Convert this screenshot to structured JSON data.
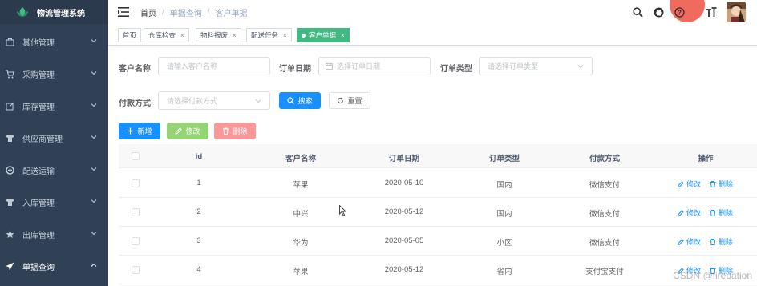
{
  "app": {
    "title": "物流管理系统"
  },
  "sidebar": {
    "items": [
      {
        "label": "其他管理",
        "icon": "bag-icon"
      },
      {
        "label": "采购管理",
        "icon": "cart-icon"
      },
      {
        "label": "库存管理",
        "icon": "edit-icon"
      },
      {
        "label": "供应商管理",
        "icon": "shirt-icon"
      },
      {
        "label": "配送运输",
        "icon": "target-icon"
      },
      {
        "label": "入库管理",
        "icon": "shirt-icon"
      },
      {
        "label": "出库管理",
        "icon": "star-icon"
      },
      {
        "label": "单据查询",
        "icon": "send-icon"
      }
    ]
  },
  "breadcrumb": [
    "首页",
    "单据查询",
    "客户单据"
  ],
  "tags": [
    {
      "label": "首页",
      "closable": false
    },
    {
      "label": "仓库检查",
      "closable": true
    },
    {
      "label": "物料报废",
      "closable": true
    },
    {
      "label": "配送任务",
      "closable": true
    },
    {
      "label": "客户单据",
      "closable": true,
      "active": true
    }
  ],
  "filters": {
    "customer_label": "客户名称",
    "customer_placeholder": "请输入客户名称",
    "date_label": "订单日期",
    "date_placeholder": "选择订单日期",
    "type_label": "订单类型",
    "type_placeholder": "请选择订单类型",
    "pay_label": "付款方式",
    "pay_placeholder": "请选择付款方式",
    "search_label": "搜索",
    "reset_label": "重置"
  },
  "toolbar": {
    "add_label": "新增",
    "edit_label": "修改",
    "delete_label": "删除"
  },
  "table": {
    "headers": [
      "id",
      "客户名称",
      "订单日期",
      "订单类型",
      "付款方式",
      "操作"
    ],
    "rows": [
      {
        "id": "1",
        "customer": "苹果",
        "date": "2020-05-10",
        "type": "国内",
        "pay": "微信支付"
      },
      {
        "id": "2",
        "customer": "中兴",
        "date": "2020-05-12",
        "type": "国内",
        "pay": "微信支付"
      },
      {
        "id": "3",
        "customer": "华为",
        "date": "2020-05-05",
        "type": "小区",
        "pay": "微信支付"
      },
      {
        "id": "4",
        "customer": "苹果",
        "date": "2020-05-12",
        "type": "省内",
        "pay": "支付宝支付"
      }
    ],
    "op_edit": "修改",
    "op_delete": "删除"
  },
  "watermark": "CSDN @firepation",
  "colors": {
    "sidebar": "#304156",
    "primary": "#1890ff",
    "tag_active": "#42b983"
  }
}
